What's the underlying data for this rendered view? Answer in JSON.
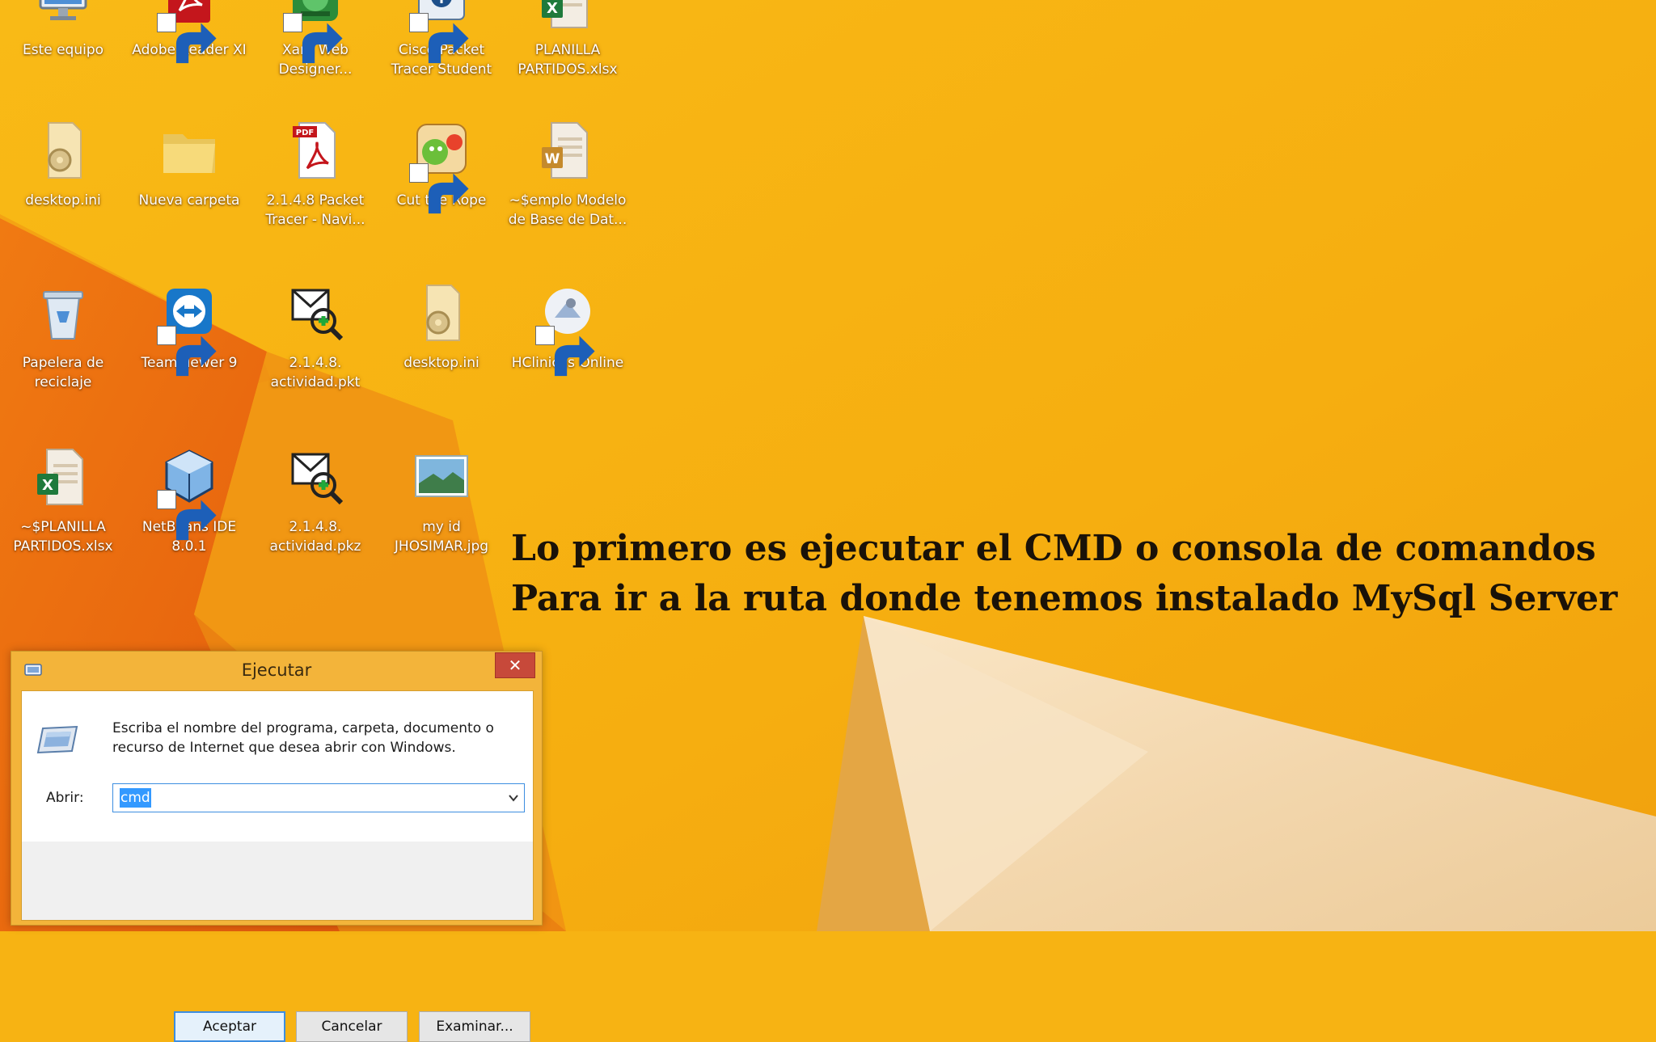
{
  "desktop": {
    "icons": [
      {
        "label": "Este equipo",
        "icon": "computer-icon"
      },
      {
        "label": "Adobe Reader XI",
        "icon": "adobe-reader-icon"
      },
      {
        "label": "Xara Web\nDesigner...",
        "icon": "xara-icon"
      },
      {
        "label": "Cisco Packet\nTracer Student",
        "icon": "cisco-packet-tracer-icon"
      },
      {
        "label": "PLANILLA\nPARTIDOS.xlsx",
        "icon": "excel-file-icon"
      },
      {
        "label": "desktop.ini",
        "icon": "settings-file-icon"
      },
      {
        "label": "Nueva carpeta",
        "icon": "folder-icon"
      },
      {
        "label": "2.1.4.8 Packet\nTracer - Navi...",
        "icon": "pdf-file-icon"
      },
      {
        "label": "Cut the Rope",
        "icon": "cut-the-rope-icon"
      },
      {
        "label": "~$emplo Modelo\nde Base de Dat...",
        "icon": "word-file-icon"
      },
      {
        "label": "Papelera de\nreciclaje",
        "icon": "recycle-bin-icon"
      },
      {
        "label": "TeamViewer 9",
        "icon": "teamviewer-icon"
      },
      {
        "label": "2.1.4.8.\nactividad.pkt",
        "icon": "packet-tracer-file-icon"
      },
      {
        "label": "desktop.ini",
        "icon": "settings-file-icon"
      },
      {
        "label": "HClinicas Online",
        "icon": "hclinicas-icon"
      },
      {
        "label": "~$PLANILLA\nPARTIDOS.xlsx",
        "icon": "excel-file-icon"
      },
      {
        "label": "NetBeans IDE\n8.0.1",
        "icon": "netbeans-icon"
      },
      {
        "label": "2.1.4.8.\nactividad.pkz",
        "icon": "packet-tracer-file-icon"
      },
      {
        "label": "my id\nJHOSIMAR.jpg",
        "icon": "image-file-icon"
      }
    ]
  },
  "caption": {
    "line1": "Lo primero es ejecutar el CMD o consola de comandos",
    "line2": "Para ir a la ruta donde tenemos instalado MySql Server"
  },
  "run_dialog": {
    "title": "Ejecutar",
    "close_glyph": "✕",
    "description": "Escriba el nombre del programa, carpeta, documento o recurso de Internet que desea abrir con Windows.",
    "open_label": "Abrir:",
    "open_value": "cmd",
    "buttons": {
      "ok": "Aceptar",
      "cancel": "Cancelar",
      "browse": "Examinar..."
    }
  },
  "colors": {
    "wallpaper_yellow": "#f7b313",
    "wallpaper_orange": "#e9650f",
    "wallpaper_cream": "#f3dcbc",
    "dialog_frame": "#f3b43a",
    "close_red": "#c7493a",
    "selection_blue": "#3399ff"
  }
}
